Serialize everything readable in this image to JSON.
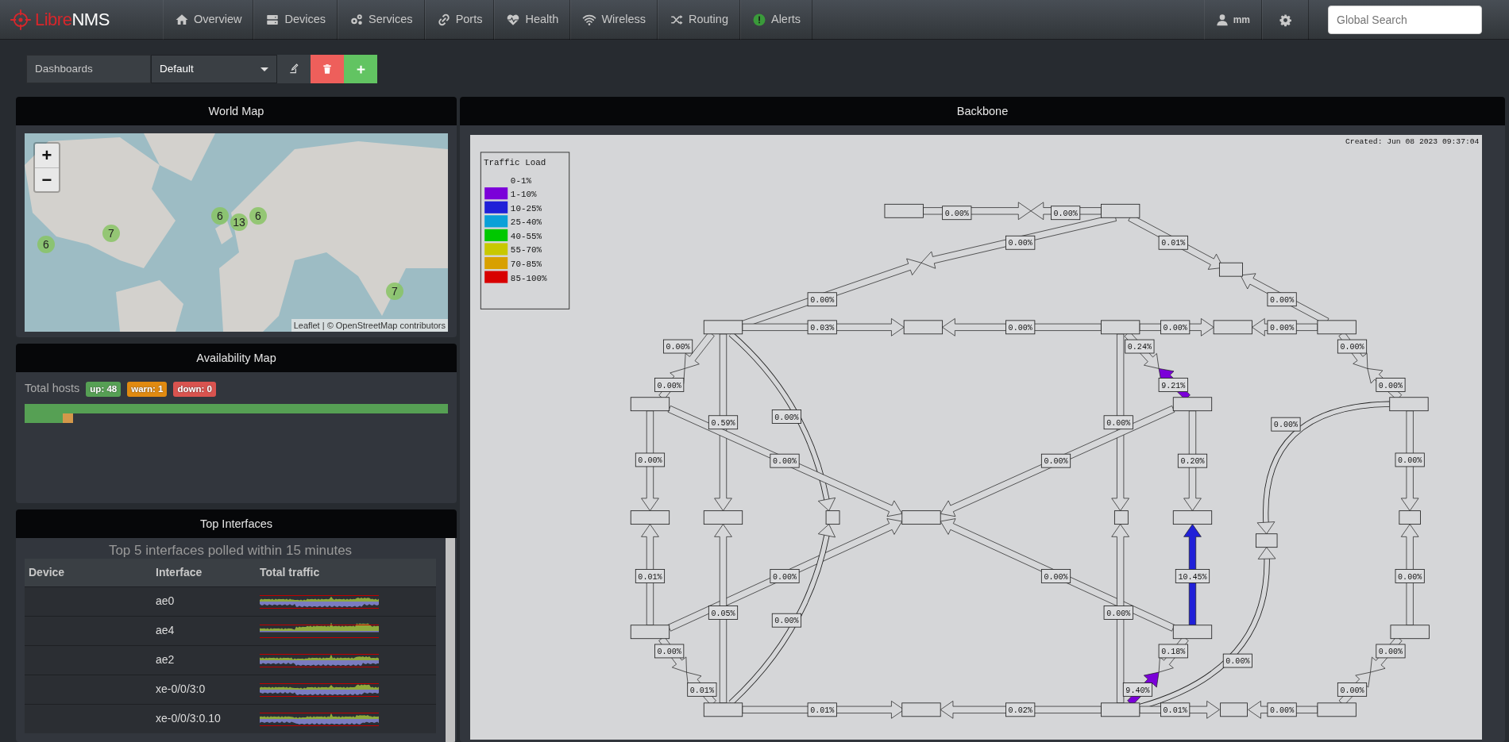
{
  "navbar": {
    "logo": [
      "Libre",
      "NMS"
    ],
    "items": [
      {
        "label": "Overview"
      },
      {
        "label": "Devices"
      },
      {
        "label": "Services"
      },
      {
        "label": "Ports"
      },
      {
        "label": "Health"
      },
      {
        "label": "Wireless"
      },
      {
        "label": "Routing"
      },
      {
        "label": "Alerts"
      }
    ],
    "user": "mm",
    "search": {
      "placeholder": "Global Search"
    }
  },
  "dashboard_bar": {
    "label": "Dashboards",
    "selected_dashboard": "Default"
  },
  "world_map": {
    "title": "World Map",
    "zoom_in": "+",
    "zoom_out": "−",
    "markers": [
      {
        "count": "6"
      },
      {
        "count": "6"
      },
      {
        "count": "13"
      },
      {
        "count": "7"
      },
      {
        "count": "6"
      },
      {
        "count": "7"
      }
    ],
    "attribution": {
      "link_1": "Leaflet",
      "text_1": "| ©",
      "link_2": "OpenStreetMap",
      "text_2": "contributors"
    }
  },
  "availability_map": {
    "title": "Availability Map",
    "label": "Total hosts",
    "badges": [
      {
        "text": "up: 48",
        "color": "#56a054"
      },
      {
        "text": "warn: 1",
        "color": "#e08a10"
      },
      {
        "text": "down: 0",
        "color": "#d9534f"
      }
    ],
    "tiles": [
      {
        "color": "#56a054"
      },
      {
        "color": "#56a054"
      },
      {
        "color": "#56a054"
      },
      {
        "color": "#56a054"
      },
      {
        "color": "#56a054"
      },
      {
        "color": "#56a054"
      },
      {
        "color": "#56a054"
      },
      {
        "color": "#56a054"
      },
      {
        "color": "#56a054"
      },
      {
        "color": "#56a054"
      },
      {
        "color": "#56a054"
      },
      {
        "color": "#56a054"
      },
      {
        "color": "#56a054"
      },
      {
        "color": "#56a054"
      },
      {
        "color": "#56a054"
      },
      {
        "color": "#56a054"
      },
      {
        "color": "#56a054"
      },
      {
        "color": "#56a054"
      },
      {
        "color": "#56a054"
      },
      {
        "color": "#56a054"
      },
      {
        "color": "#56a054"
      },
      {
        "color": "#56a054"
      },
      {
        "color": "#56a054"
      },
      {
        "color": "#56a054"
      },
      {
        "color": "#56a054"
      },
      {
        "color": "#56a054"
      },
      {
        "color": "#56a054"
      },
      {
        "color": "#56a054"
      },
      {
        "color": "#56a054"
      },
      {
        "color": "#56a054"
      },
      {
        "color": "#56a054"
      },
      {
        "color": "#56a054"
      },
      {
        "color": "#56a054"
      },
      {
        "color": "#56a054"
      },
      {
        "color": "#56a054"
      },
      {
        "color": "#56a054"
      },
      {
        "color": "#56a054"
      },
      {
        "color": "#56a054"
      },
      {
        "color": "#56a054"
      },
      {
        "color": "#56a054"
      },
      {
        "color": "#56a054"
      },
      {
        "color": "#56a054"
      },
      {
        "color": "#56a054"
      },
      {
        "color": "#56a054"
      },
      {
        "color": "#56a054"
      },
      {
        "color": "#56a054"
      },
      {
        "color": "#56a054"
      },
      {
        "color": "#56a054"
      },
      {
        "color": "#d4984a"
      }
    ]
  },
  "top_interfaces": {
    "title": "Top Interfaces",
    "heading": "Top 5 interfaces polled within 15 minutes",
    "columns": [
      "Device",
      "Interface",
      "Total traffic"
    ],
    "rows": [
      {
        "interface": "ae0"
      },
      {
        "interface": "ae4"
      },
      {
        "interface": "ae2"
      },
      {
        "interface": "xe-0/0/3:0"
      },
      {
        "interface": "xe-0/0/3:0.10"
      }
    ]
  },
  "backbone": {
    "title": "Backbone",
    "created": "Created: Jun 08 2023 09:37:04",
    "legend": {
      "title": "Traffic Load",
      "items": [
        {
          "label": "0-1%"
        },
        {
          "label": "1-10%",
          "color": "#7b00d9"
        },
        {
          "label": "10-25%",
          "color": "#2020d8"
        },
        {
          "label": "25-40%",
          "color": "#0aa0d8"
        },
        {
          "label": "40-55%",
          "color": "#00c800"
        },
        {
          "label": "55-70%",
          "color": "#c8c800"
        },
        {
          "label": "70-85%",
          "color": "#d8a000"
        },
        {
          "label": "85-100%",
          "color": "#d80000"
        }
      ]
    },
    "links": [
      {
        "label": "0.00%",
        "color": "#d6d7d9"
      },
      {
        "label": "0.00%",
        "color": "#d6d7d9"
      },
      {
        "label": "0.00%",
        "color": "#d6d7d9"
      },
      {
        "label": "0.01%",
        "color": "#d6d7d9"
      },
      {
        "label": "0.00%",
        "color": "#d6d7d9"
      },
      {
        "label": "0.00%",
        "color": "#d6d7d9"
      },
      {
        "label": "0.03%",
        "color": "#d6d7d9"
      },
      {
        "label": "0.00%",
        "color": "#d6d7d9"
      },
      {
        "label": "0.00%",
        "color": "#d6d7d9"
      },
      {
        "label": "0.00%",
        "color": "#d6d7d9"
      },
      {
        "label": "0.00%",
        "color": "#d6d7d9"
      },
      {
        "label": "0.24%",
        "color": "#d6d7d9"
      },
      {
        "label": "0.00%",
        "color": "#d6d7d9"
      },
      {
        "label": "0.00%",
        "color": "#d6d7d9"
      },
      {
        "label": "9.21%",
        "color": "#7b00d9"
      },
      {
        "label": "0.00%",
        "color": "#d6d7d9"
      },
      {
        "label": "0.59%",
        "color": "#d6d7d9"
      },
      {
        "label": "0.00%",
        "color": "#d6d7d9"
      },
      {
        "label": "0.00%",
        "color": "#d6d7d9"
      },
      {
        "label": "0.00%",
        "color": "#d6d7d9"
      },
      {
        "label": "0.00%",
        "color": "#d6d7d9"
      },
      {
        "label": "0.00%",
        "color": "#d6d7d9"
      },
      {
        "label": "0.00%",
        "color": "#d6d7d9"
      },
      {
        "label": "0.20%",
        "color": "#d6d7d9"
      },
      {
        "label": "0.00%",
        "color": "#d6d7d9"
      },
      {
        "label": "0.01%",
        "color": "#d6d7d9"
      },
      {
        "label": "0.00%",
        "color": "#d6d7d9"
      },
      {
        "label": "0.00%",
        "color": "#d6d7d9"
      },
      {
        "label": "10.45%",
        "color": "#2020d8"
      },
      {
        "label": "0.00%",
        "color": "#d6d7d9"
      },
      {
        "label": "0.05%",
        "color": "#d6d7d9"
      },
      {
        "label": "0.00%",
        "color": "#d6d7d9"
      },
      {
        "label": "0.00%",
        "color": "#d6d7d9"
      },
      {
        "label": "0.00%",
        "color": "#d6d7d9"
      },
      {
        "label": "0.18%",
        "color": "#d6d7d9"
      },
      {
        "label": "0.00%",
        "color": "#d6d7d9"
      },
      {
        "label": "0.00%",
        "color": "#d6d7d9"
      },
      {
        "label": "0.01%",
        "color": "#d6d7d9"
      },
      {
        "label": "9.40%",
        "color": "#7b00d9"
      },
      {
        "label": "0.00%",
        "color": "#d6d7d9"
      },
      {
        "label": "0.01%",
        "color": "#d6d7d9"
      },
      {
        "label": "0.02%",
        "color": "#d6d7d9"
      },
      {
        "label": "0.01%",
        "color": "#d6d7d9"
      },
      {
        "label": "0.00%",
        "color": "#d6d7d9"
      }
    ]
  }
}
